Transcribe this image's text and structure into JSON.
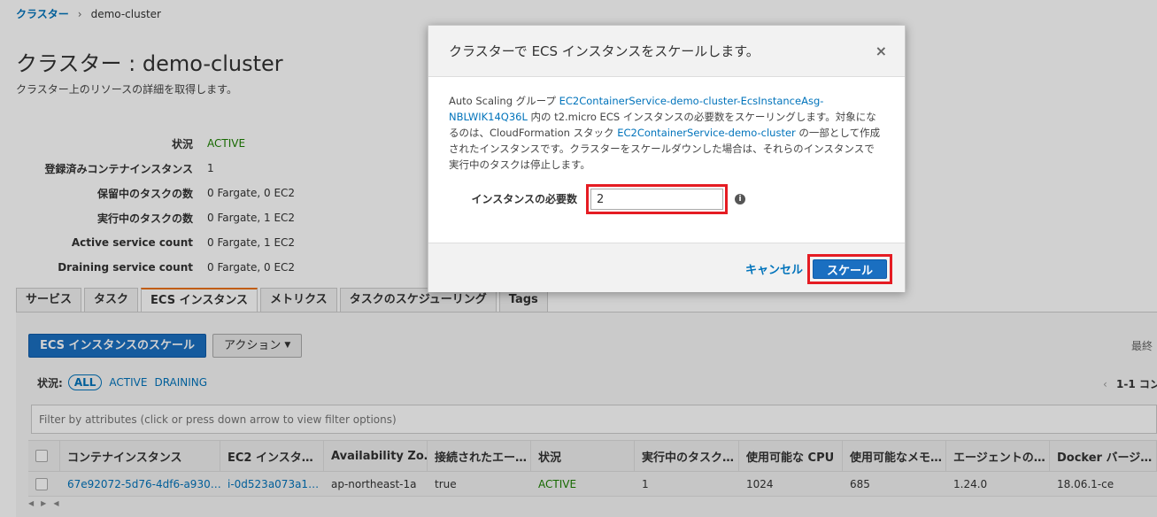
{
  "breadcrumb": {
    "parent": "クラスター",
    "current": "demo-cluster"
  },
  "page": {
    "title": "クラスター : demo-cluster",
    "subtitle": "クラスター上のリソースの詳細を取得します。"
  },
  "details": [
    {
      "label": "状況",
      "value": "ACTIVE"
    },
    {
      "label": "登録済みコンテナインスタンス",
      "value": "1"
    },
    {
      "label": "保留中のタスクの数",
      "value": "0 Fargate, 0 EC2"
    },
    {
      "label": "実行中のタスクの数",
      "value": "0 Fargate, 1 EC2"
    },
    {
      "label": "Active service count",
      "value": "0 Fargate, 1 EC2"
    },
    {
      "label": "Draining service count",
      "value": "0 Fargate, 0 EC2"
    }
  ],
  "tabs": [
    "サービス",
    "タスク",
    "ECS インスタンス",
    "メトリクス",
    "タスクのスケジューリング",
    "Tags"
  ],
  "toolbar": {
    "scale_button": "ECS インスタンスのスケール",
    "actions_button": "アクション",
    "right_cut": "最終"
  },
  "filter": {
    "status_label": "状況:",
    "all": "ALL",
    "active": "ACTIVE",
    "draining": "DRAINING",
    "pager": "1-1 コン",
    "placeholder": "Filter by attributes (click or press down arrow to view filter options)"
  },
  "table": {
    "headers": [
      "コンテナインスタンス",
      "EC2 インスタ…",
      "Availability Zo…",
      "接続されたエー…",
      "状況",
      "実行中のタスク…",
      "使用可能な CPU",
      "使用可能なメモ…",
      "エージェントの…",
      "Docker バージ…"
    ],
    "rows": [
      [
        "67e92072-5d76-4df6-a930…",
        "i-0d523a073a1…",
        "ap-northeast-1a",
        "true",
        "ACTIVE",
        "1",
        "1024",
        "685",
        "1.24.0",
        "18.06.1-ce"
      ]
    ]
  },
  "modal": {
    "title": "クラスターで ECS インスタンスをスケールします。",
    "body_1": "Auto Scaling グループ ",
    "asg_link": "EC2ContainerService-demo-cluster-EcsInstanceAsg-NBLWIK14Q36L",
    "body_2": " 内の t2.micro ECS インスタンスの必要数をスケーリングします。対象になるのは、CloudFormation スタック ",
    "stack_link": "EC2ContainerService-demo-cluster",
    "body_3": " の一部として作成されたインスタンスです。クラスターをスケールダウンした場合は、それらのインスタンスで実行中のタスクは停止します。",
    "field_label": "インスタンスの必要数",
    "field_value": "2",
    "cancel": "キャンセル",
    "scale": "スケール"
  }
}
